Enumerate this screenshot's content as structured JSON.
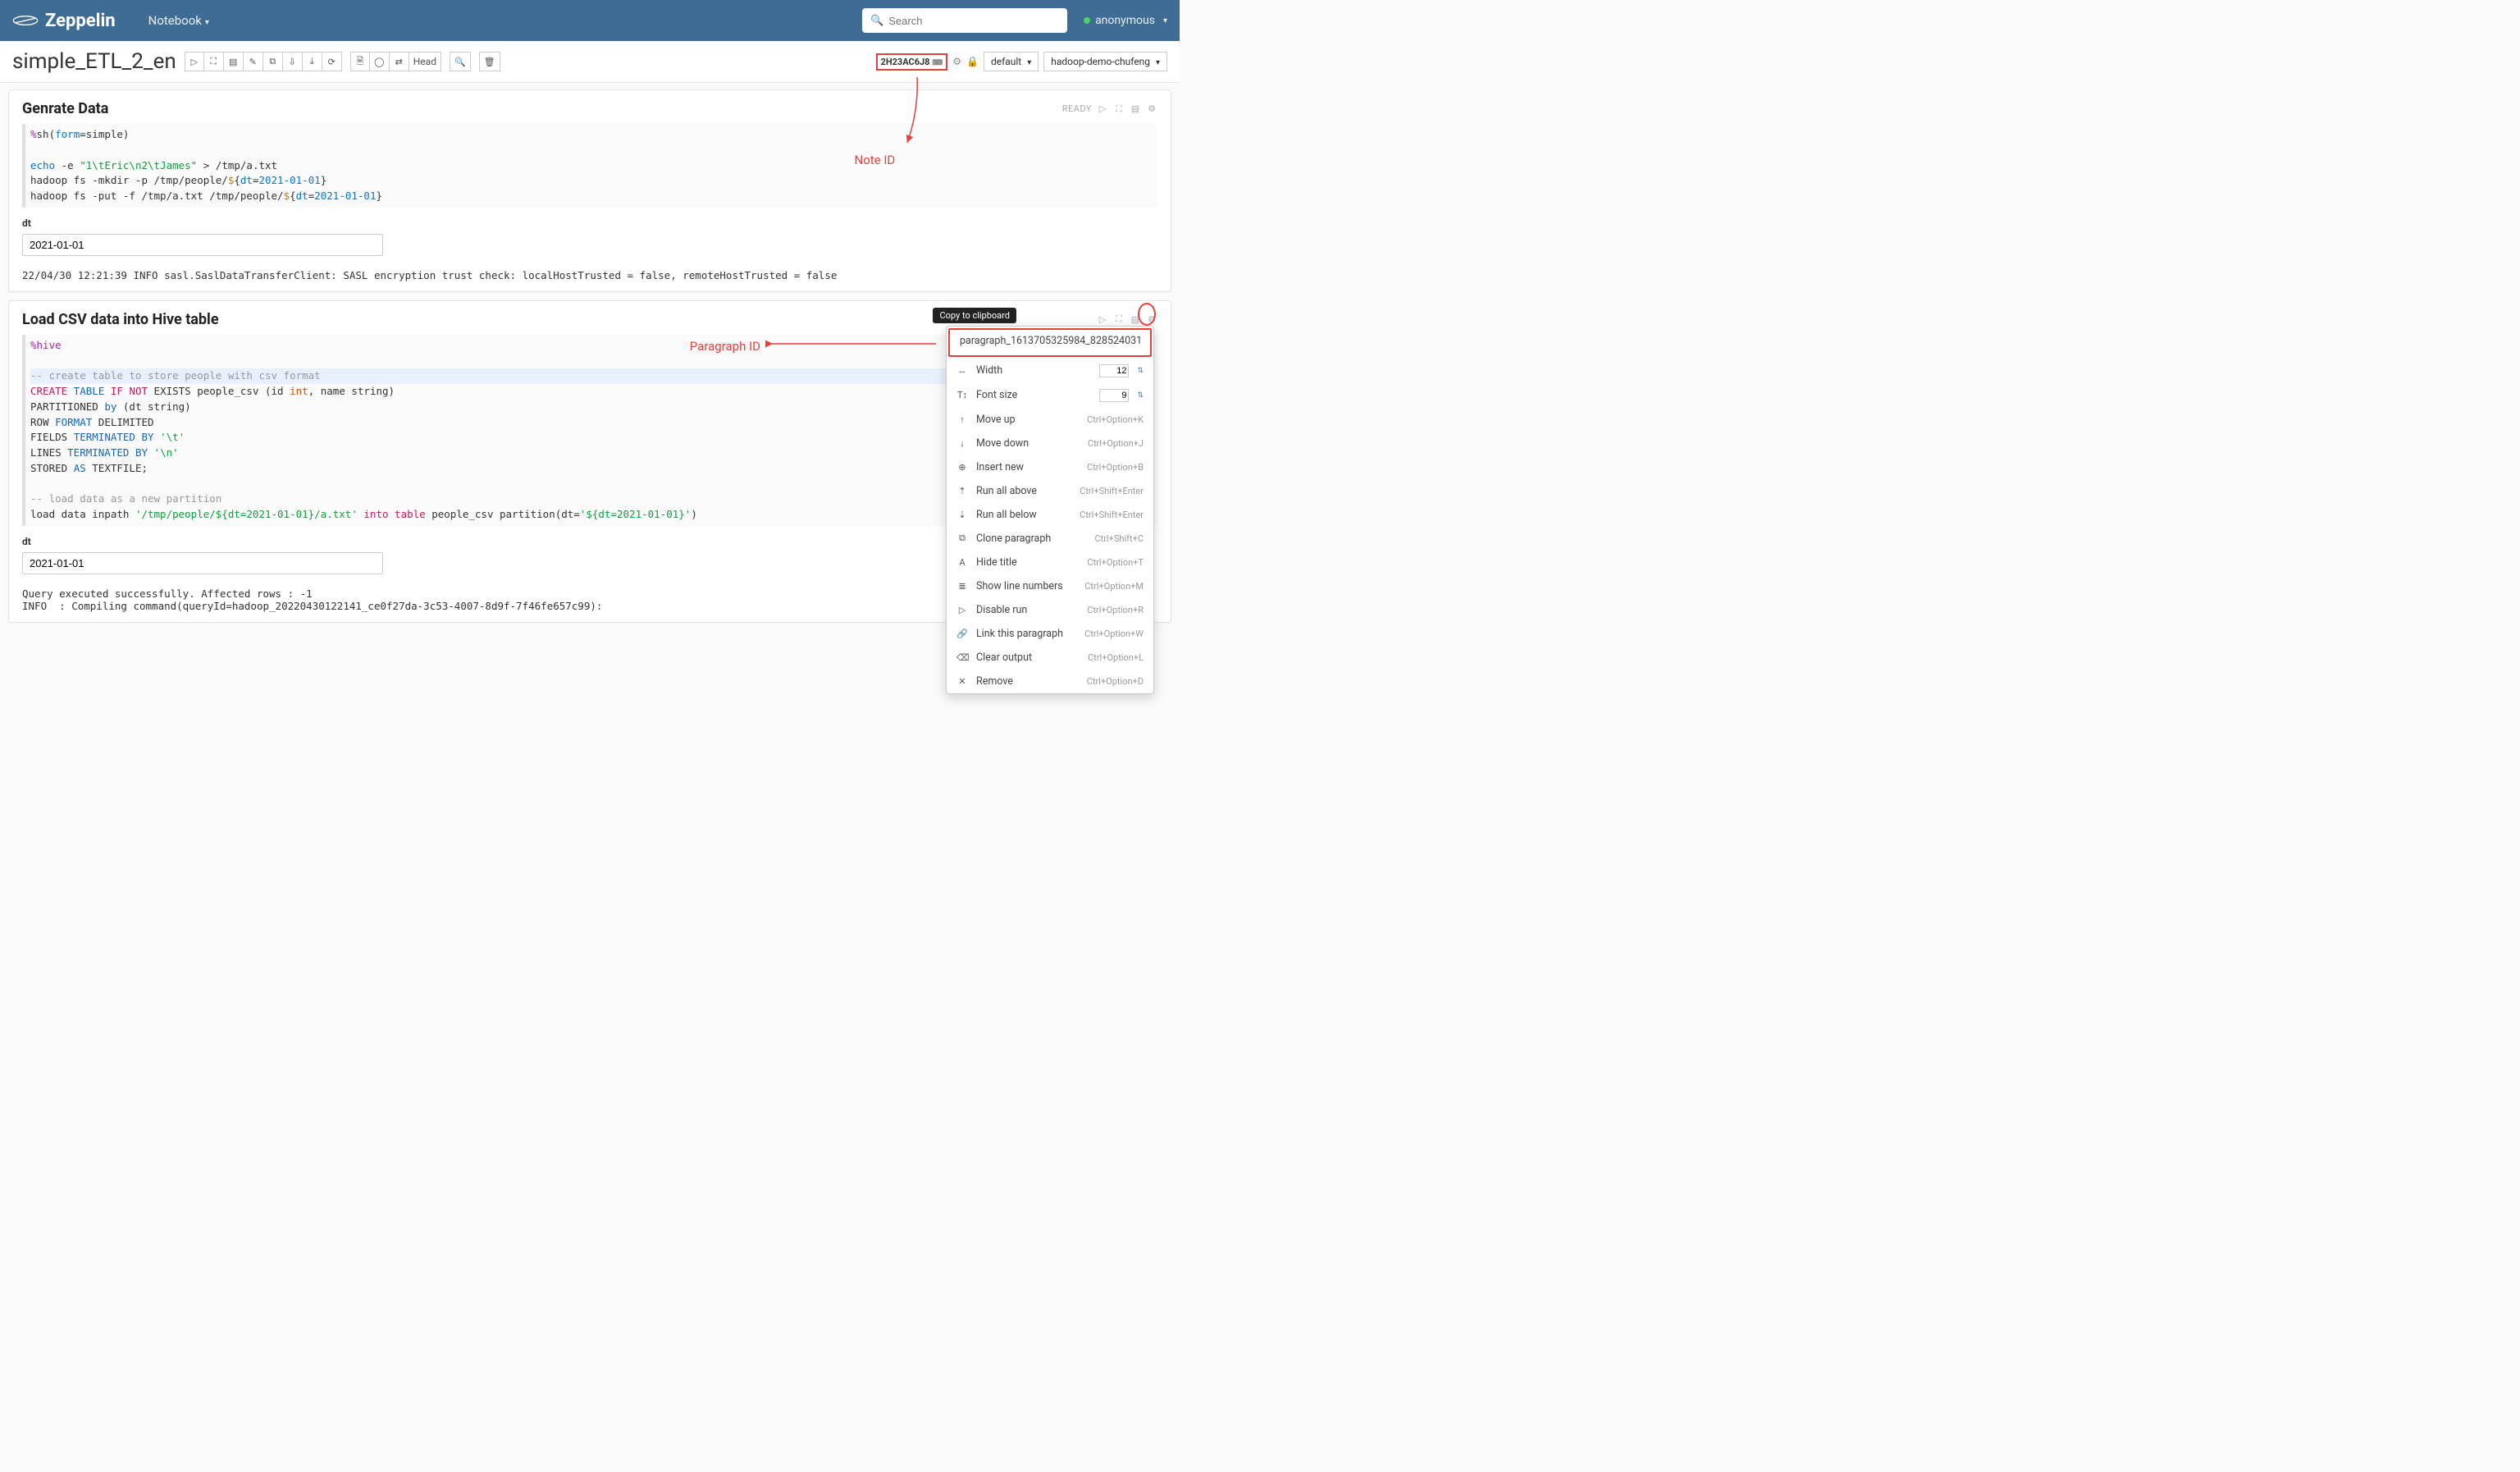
{
  "nav": {
    "brand": "Zeppelin",
    "notebook": "Notebook",
    "search_placeholder": "Search",
    "user": "anonymous"
  },
  "toolbar": {
    "title": "simple_ETL_2_en",
    "head_label": "Head",
    "note_id": "2H23AC6J8",
    "default_label": "default",
    "cluster_label": "hadoop-demo-chufeng"
  },
  "annot": {
    "note_id": "Note ID",
    "para_id": "Paragraph ID",
    "copy_tooltip": "Copy to clipboard"
  },
  "para1": {
    "title": "Genrate Data",
    "status": "READY",
    "code_tokens": {
      "t1": "%",
      "t2": "sh",
      "t3": "(",
      "t4": "form",
      "t5": "=",
      "t6": "simple",
      "t7": ")",
      "l2a": "echo",
      "l2b": " -e ",
      "l2c": "\"1\\tEric\\n2\\tJames\"",
      "l2d": " > /tmp/a.txt",
      "l3a": "hadoop fs -mkdir -p /tmp/people/",
      "l3b": "$",
      "l3c": "{",
      "l3d": "dt",
      "l3e": "=",
      "l3f": "2021-01-01",
      "l3g": "}",
      "l4a": "hadoop fs -put -f /tmp/a.txt /tmp/people/",
      "l4b": "$",
      "l4c": "{",
      "l4d": "dt",
      "l4e": "=",
      "l4f": "2021-01-01",
      "l4g": "}"
    },
    "dt_label": "dt",
    "dt_value": "2021-01-01",
    "output": "22/04/30 12:21:39 INFO sasl.SaslDataTransferClient: SASL encryption trust check: localHostTrusted = false, remoteHostTrusted = false"
  },
  "para2": {
    "title": "Load CSV data into Hive table",
    "code_tokens": {
      "l1": "%hive",
      "c1": "-- create table to store people with csv format",
      "l3a": "CREATE",
      "l3b": " TABLE ",
      "l3c": "IF",
      "l3d": " ",
      "l3e": "NOT",
      "l3f": " EXISTS people_csv (id ",
      "l3g": "int",
      "l3h": ", name string)",
      "l4a": "PARTITIONED ",
      "l4b": "by",
      "l4c": " (dt string)",
      "l5a": "ROW ",
      "l5b": "FORMAT",
      "l5c": " DELIMITED",
      "l6a": "FIELDS ",
      "l6b": "TERMINATED",
      "l6c": " ",
      "l6d": "BY",
      "l6e": " ",
      "l6f": "'\\t'",
      "l7a": "LINES ",
      "l7b": "TERMINATED",
      "l7c": " ",
      "l7d": "BY",
      "l7e": " ",
      "l7f": "'\\n'",
      "l8a": "STORED ",
      "l8b": "AS",
      "l8c": " TEXTFILE;",
      "c2": "-- load data as a new partition",
      "l10a": "load data inpath ",
      "l10b": "'/tmp/people/${dt=2021-01-01}/a.txt'",
      "l10c": " ",
      "l10d": "into",
      "l10e": " ",
      "l10f": "table",
      "l10g": " people_csv partition(dt=",
      "l10h": "'${dt=2021-01-01}'",
      "l10i": ")"
    },
    "dt_label": "dt",
    "dt_value": "2021-01-01",
    "output": "Query executed successfully. Affected rows : -1\nINFO  : Compiling command(queryId=hadoop_20220430122141_ce0f27da-3c53-4007-8d9f-7f46fe657c99):"
  },
  "dropdown": {
    "paragraph_id": "paragraph_1613705325984_828524031",
    "items": [
      {
        "icon": "↔",
        "label": "Width",
        "input": "12"
      },
      {
        "icon": "T↕",
        "label": "Font size",
        "input": "9"
      },
      {
        "icon": "↑",
        "label": "Move up",
        "shortcut": "Ctrl+Option+K"
      },
      {
        "icon": "↓",
        "label": "Move down",
        "shortcut": "Ctrl+Option+J"
      },
      {
        "icon": "⊕",
        "label": "Insert new",
        "shortcut": "Ctrl+Option+B"
      },
      {
        "icon": "⇡",
        "label": "Run all above",
        "shortcut": "Ctrl+Shift+Enter"
      },
      {
        "icon": "⇣",
        "label": "Run all below",
        "shortcut": "Ctrl+Shift+Enter"
      },
      {
        "icon": "⧉",
        "label": "Clone paragraph",
        "shortcut": "Ctrl+Shift+C"
      },
      {
        "icon": "A",
        "label": "Hide title",
        "shortcut": "Ctrl+Option+T"
      },
      {
        "icon": "≣",
        "label": "Show line numbers",
        "shortcut": "Ctrl+Option+M"
      },
      {
        "icon": "▷",
        "label": "Disable run",
        "shortcut": "Ctrl+Option+R"
      },
      {
        "icon": "🔗",
        "label": "Link this paragraph",
        "shortcut": "Ctrl+Option+W"
      },
      {
        "icon": "⌫",
        "label": "Clear output",
        "shortcut": "Ctrl+Option+L"
      },
      {
        "icon": "✕",
        "label": "Remove",
        "shortcut": "Ctrl+Option+D"
      }
    ]
  }
}
